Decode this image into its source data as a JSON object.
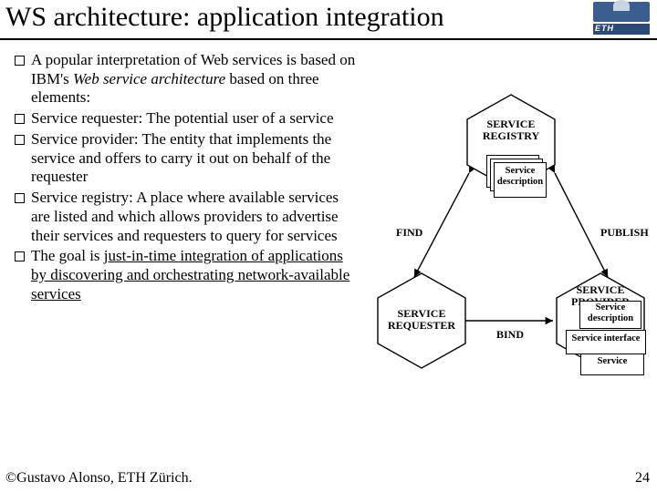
{
  "title": "WS architecture: application integration",
  "logo": {
    "text": "ETH"
  },
  "bullets": [
    {
      "pre": "A popular interpretation of Web services is based on IBM's ",
      "em": "Web service architecture",
      "post": " based on three elements:"
    },
    {
      "text": "Service requester: The potential user of a service"
    },
    {
      "text": "Service provider: The entity that implements the service and offers to carry it out on behalf of the requester"
    },
    {
      "text": "Service registry: A place where available services are listed and which allows providers to advertise their services and requesters to query for services"
    },
    {
      "pre": "The goal is ",
      "u": "just-in-time integration of applications by discovering and orchestrating network-available services",
      "post": ""
    }
  ],
  "diagram": {
    "nodes": {
      "registry": {
        "line1": "SERVICE",
        "line2": "REGISTRY"
      },
      "requester": {
        "line1": "SERVICE",
        "line2": "REQUESTER"
      },
      "provider": {
        "line1": "SERVICE",
        "line2": "PROVIDER"
      }
    },
    "serviceDescription": {
      "line1": "Service",
      "line2": "description"
    },
    "providerBoxes": {
      "sd": "Service description",
      "si": "Service interface",
      "sv": "Service"
    },
    "edges": {
      "find": "FIND",
      "publish": "PUBLISH",
      "bind": "BIND"
    }
  },
  "footer": {
    "left": "©Gustavo Alonso,  ETH Zürich.",
    "right": "24"
  }
}
